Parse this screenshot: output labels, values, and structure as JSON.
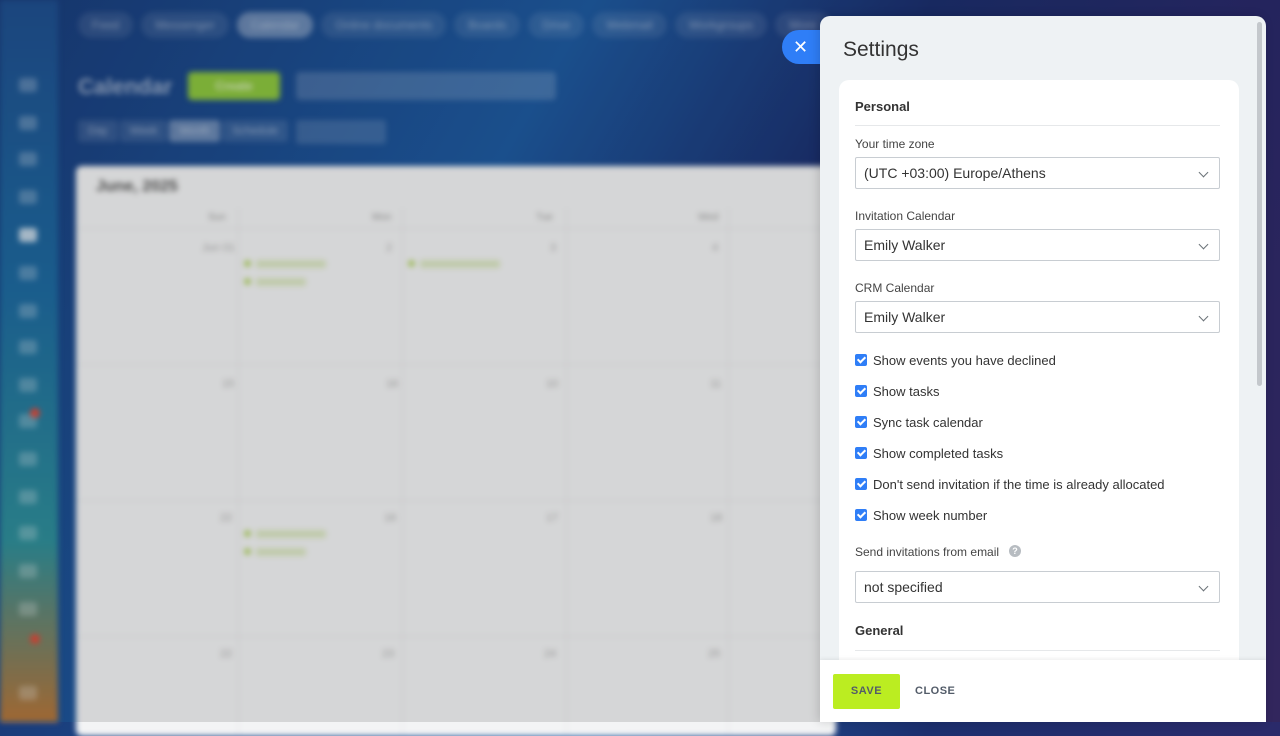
{
  "background": {
    "top_nav": [
      "Feed",
      "Messenger",
      "Calendar",
      "Online documents",
      "Boards",
      "Drive",
      "Webmail",
      "Workgroups",
      "More"
    ],
    "page_title": "Calendar",
    "create_label": "Create",
    "views": [
      "Day",
      "Week",
      "Month",
      "Schedule"
    ],
    "month_label": "June, 2025",
    "weekdays": [
      "Sun",
      "Mon",
      "Tue",
      "Wed"
    ],
    "week_rows": [
      [
        "Jun 01",
        "2",
        "3",
        "4"
      ],
      [
        "15",
        "16",
        "10",
        "11"
      ],
      [
        "22",
        "16",
        "17",
        "18"
      ],
      [
        "22",
        "23",
        "24",
        "25"
      ]
    ]
  },
  "panel": {
    "close_icon": "close-icon",
    "title": "Settings",
    "personal": {
      "section_title": "Personal",
      "timezone": {
        "label": "Your time zone",
        "value": "(UTC +03:00) Europe/Athens"
      },
      "invitation_calendar": {
        "label": "Invitation Calendar",
        "value": "Emily Walker"
      },
      "crm_calendar": {
        "label": "CRM Calendar",
        "value": "Emily Walker"
      },
      "checkboxes": [
        {
          "label": "Show events you have declined",
          "checked": true
        },
        {
          "label": "Show tasks",
          "checked": true
        },
        {
          "label": "Sync task calendar",
          "checked": true
        },
        {
          "label": "Show completed tasks",
          "checked": true
        },
        {
          "label": "Don't send invitation if the time is already allocated",
          "checked": true
        },
        {
          "label": "Show week number",
          "checked": true
        }
      ],
      "send_from_email": {
        "label": "Send invitations from email",
        "value": "not specified"
      }
    },
    "general": {
      "section_title": "General"
    },
    "footer": {
      "save_label": "SAVE",
      "close_label": "CLOSE"
    },
    "colors": {
      "accent": "#2f7ef7",
      "save": "#bbed21"
    }
  }
}
